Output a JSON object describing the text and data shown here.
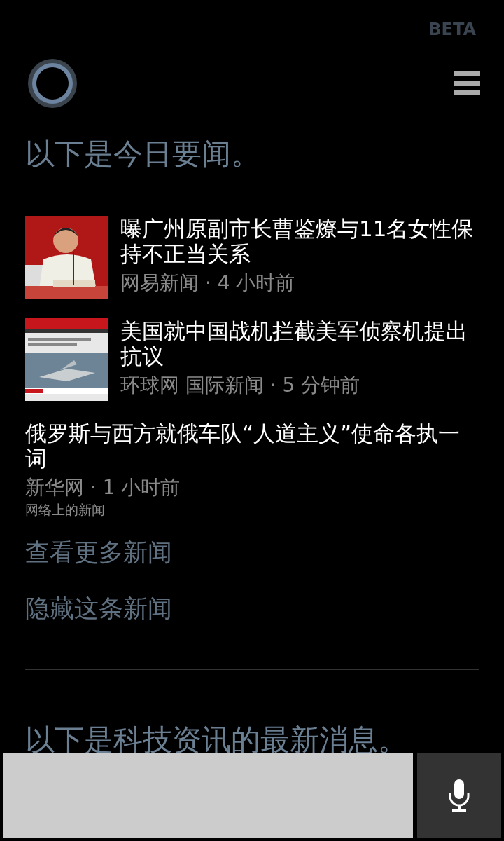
{
  "beta_label": "BETA",
  "heading": "以下是今日要闻。",
  "news": [
    {
      "kind": "picture",
      "title": "曝广州原副市长曹鉴燎与11名女性保持不正当关系",
      "meta": "网易新闻 · 4 小时前"
    },
    {
      "kind": "picture",
      "title": "美国就中国战机拦截美军侦察机提出抗议",
      "meta": "环球网 国际新闻 · 5 分钟前"
    },
    {
      "kind": "text",
      "title": "俄罗斯与西方就俄车队“人道主义”使命各执一词",
      "meta": "新华网 · 1 小时前",
      "note": "网络上的新闻"
    }
  ],
  "links": [
    "查看更多新闻",
    "隐藏这条新闻"
  ],
  "next_heading": "以下是科技资讯的最新消息。"
}
